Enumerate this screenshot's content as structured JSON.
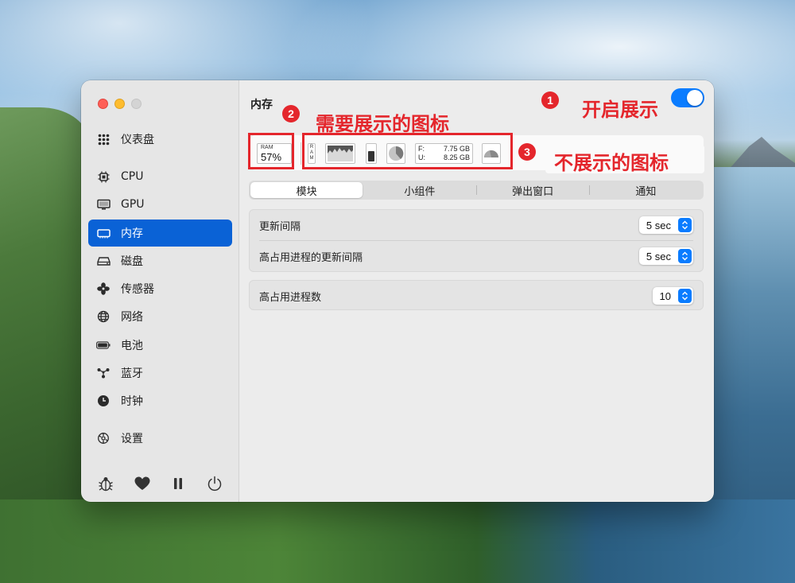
{
  "sidebar": {
    "items": [
      {
        "label": "仪表盘",
        "icon": "dashboard-icon"
      },
      {
        "label": "CPU",
        "icon": "cpu-icon"
      },
      {
        "label": "GPU",
        "icon": "gpu-icon"
      },
      {
        "label": "内存",
        "icon": "ram-icon",
        "active": true
      },
      {
        "label": "磁盘",
        "icon": "disk-icon"
      },
      {
        "label": "传感器",
        "icon": "fan-icon"
      },
      {
        "label": "网络",
        "icon": "globe-icon"
      },
      {
        "label": "电池",
        "icon": "battery-icon"
      },
      {
        "label": "蓝牙",
        "icon": "bluetooth-icon"
      },
      {
        "label": "时钟",
        "icon": "clock-icon"
      },
      {
        "label": "设置",
        "icon": "gear-icon"
      }
    ],
    "footer_icons": [
      "bug-icon",
      "heart-icon",
      "pause-icon",
      "power-icon"
    ]
  },
  "main": {
    "title": "内存",
    "toggle_on": true,
    "widgets": {
      "ram_label": "RAM",
      "ram_value": "57%",
      "vertical_label": "RAM",
      "free_label": "F:",
      "free_value": "7.75 GB",
      "used_label": "U:",
      "used_value": "8.25 GB"
    },
    "tabs": [
      {
        "label": "模块",
        "active": true
      },
      {
        "label": "小组件"
      },
      {
        "label": "弹出窗口"
      },
      {
        "label": "通知"
      }
    ],
    "settings": {
      "update_interval_label": "更新间隔",
      "update_interval_value": "5 sec",
      "top_process_interval_label": "高占用进程的更新间隔",
      "top_process_interval_value": "5 sec",
      "top_process_count_label": "高占用进程数",
      "top_process_count_value": "10"
    }
  },
  "annotations": {
    "badge1": "1",
    "badge2": "2",
    "badge3": "3",
    "note1": "开启展示",
    "note2": "需要展示的图标",
    "note3": "不展示的图标"
  },
  "colors": {
    "accent": "#0a62d6",
    "toggle": "#0a7cff",
    "annotation_red": "#e4262c"
  }
}
